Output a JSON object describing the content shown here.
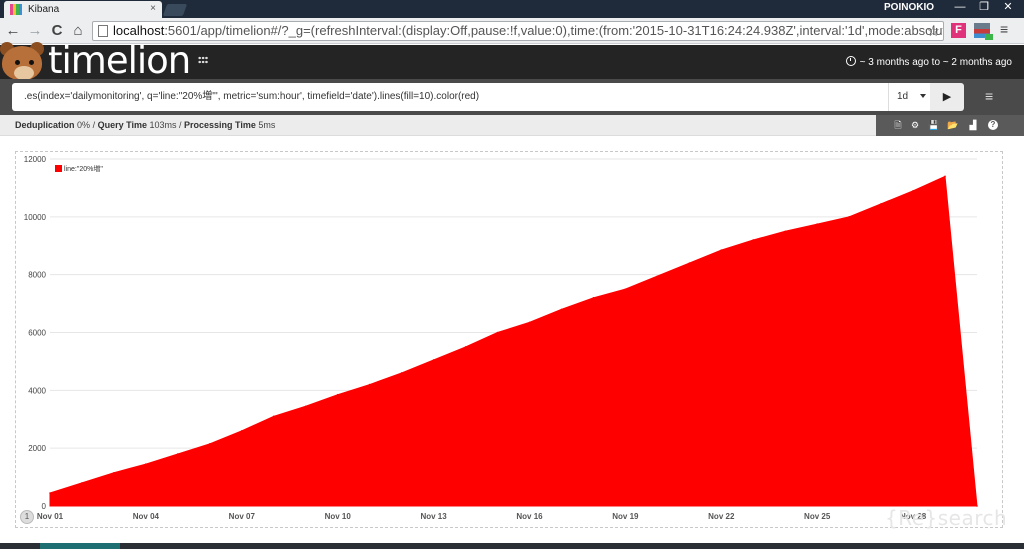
{
  "browser": {
    "tab_title": "Kibana",
    "tab_close": "×",
    "user_name": "POINOKIO",
    "window_min": "—",
    "window_restore": "❐",
    "window_close": "✕",
    "back_glyph": "←",
    "forward_glyph": "→",
    "reload_glyph": "C",
    "home_glyph": "⌂",
    "url_host": "localhost",
    "url_rest": ":5601/app/timelion#/?_g=(refreshInterval:(display:Off,pause:!f,value:0),time:(from:'2015-10-31T16:24:24.938Z',interval:'1d',mode:absolute,timezone:",
    "star_glyph": "☆",
    "extension_letter": "F",
    "menu_glyph": "≡"
  },
  "app": {
    "logo_text": "timelion",
    "time_range": "~ 3 months ago to ~ 2 months ago",
    "expression": ".es(index='dailymonitoring', q='line:\"20%増\"', metric='sum:hour', timefield='date').lines(fill=10).color(red)",
    "interval": "1d",
    "run_glyph": "▶",
    "menu_glyph": "≡",
    "stats": {
      "dedup_label": "Deduplication",
      "dedup_value": "0%",
      "query_label": "Query Time",
      "query_value": "103ms",
      "processing_label": "Processing Time",
      "processing_value": "5ms",
      "sep": "/"
    },
    "actions": {
      "new_glyph": "🗎",
      "settings_glyph": "⚙",
      "save_glyph": "💾",
      "open_glyph": "📂",
      "chart_glyph": "▟",
      "help_glyph": "?"
    },
    "panel_index": "1",
    "watermark": "{Re}search"
  },
  "colors": {
    "series": "#ff0000",
    "header_bg": "#242424",
    "query_bar_bg": "#4a4a4a"
  },
  "chart_data": {
    "type": "area",
    "legend_position": "top-left",
    "grid": true,
    "ylim": [
      0,
      12000
    ],
    "yticks": [
      0,
      2000,
      4000,
      6000,
      8000,
      10000,
      12000
    ],
    "x_tick_labels": [
      "Nov 01",
      "Nov 04",
      "Nov 07",
      "Nov 10",
      "Nov 13",
      "Nov 16",
      "Nov 19",
      "Nov 22",
      "Nov 25",
      "Nov 28"
    ],
    "x_tick_days": [
      1,
      4,
      7,
      10,
      13,
      16,
      19,
      22,
      25,
      28
    ],
    "xlim_days": [
      1,
      30
    ],
    "series": [
      {
        "name": "line:\"20%増\"",
        "color": "#ff0000",
        "x_days": [
          1,
          2,
          3,
          4,
          5,
          6,
          7,
          8,
          9,
          10,
          11,
          12,
          13,
          14,
          15,
          16,
          17,
          18,
          19,
          20,
          21,
          22,
          23,
          24,
          25,
          26,
          27,
          28,
          29,
          30
        ],
        "values": [
          450,
          800,
          1150,
          1450,
          1800,
          2150,
          2600,
          3100,
          3450,
          3850,
          4200,
          4600,
          5050,
          5500,
          6000,
          6350,
          6800,
          7200,
          7500,
          7950,
          8400,
          8850,
          9200,
          9500,
          9750,
          10000,
          10450,
          10900,
          11400,
          0
        ]
      }
    ]
  }
}
